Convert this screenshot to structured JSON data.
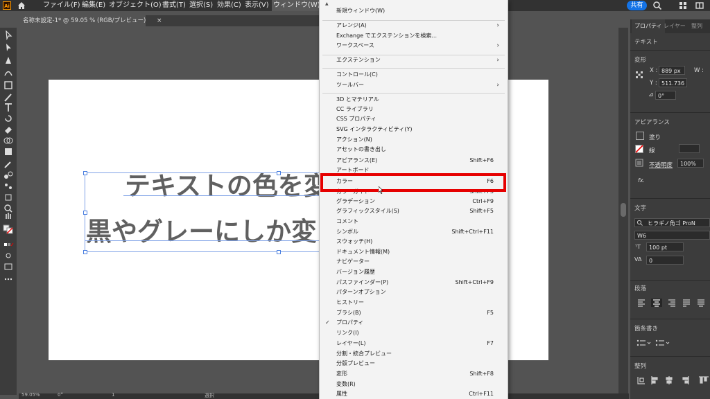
{
  "app": {
    "logo": "Ai",
    "share_label": "共有"
  },
  "menubar": {
    "items": [
      "ファイル(F)",
      "編集(E)",
      "オブジェクト(O)",
      "書式(T)",
      "選択(S)",
      "効果(C)",
      "表示(V)",
      "ウィンドウ(W)"
    ]
  },
  "document_tab": {
    "title": "名称未設定-1* @ 59.05 % (RGB/プレビュー)",
    "close": "×"
  },
  "artboard": {
    "line1": "テキストの色を変",
    "line2": "黒やグレーにしか変"
  },
  "status": {
    "zoom": "59.05%",
    "angle": "0°",
    "page": "1",
    "mode": "選択"
  },
  "window_menu": {
    "items": [
      {
        "label": "新規ウィンドウ(W)",
        "shortcut": ""
      },
      {
        "label": "アレンジ(A)",
        "submenu": true
      },
      {
        "label": "Exchange でエクステンションを検索...",
        "shortcut": ""
      },
      {
        "label": "ワークスペース",
        "submenu": true
      },
      {
        "label": "エクステンション",
        "submenu": true
      },
      {
        "label": "コントロール(C)",
        "shortcut": ""
      },
      {
        "label": "ツールバー",
        "submenu": true
      },
      {
        "label": "3D とマテリアル",
        "shortcut": ""
      },
      {
        "label": "CC ライブラリ",
        "shortcut": ""
      },
      {
        "label": "CSS プロパティ",
        "shortcut": ""
      },
      {
        "label": "SVG インタラクティビティ(Y)",
        "shortcut": ""
      },
      {
        "label": "アクション(N)",
        "shortcut": ""
      },
      {
        "label": "アセットの書き出し",
        "shortcut": ""
      },
      {
        "label": "アピアランス(E)",
        "shortcut": "Shift+F6"
      },
      {
        "label": "アートボード",
        "shortcut": ""
      },
      {
        "label": "カラー",
        "shortcut": "F6"
      },
      {
        "label": "カラーガイド",
        "shortcut": "Shift+F3"
      },
      {
        "label": "グラデーション",
        "shortcut": "Ctrl+F9"
      },
      {
        "label": "グラフィックスタイル(S)",
        "shortcut": "Shift+F5"
      },
      {
        "label": "コメント",
        "shortcut": ""
      },
      {
        "label": "シンボル",
        "shortcut": "Shift+Ctrl+F11"
      },
      {
        "label": "スウォッチ(H)",
        "shortcut": ""
      },
      {
        "label": "ドキュメント情報(M)",
        "shortcut": ""
      },
      {
        "label": "ナビゲーター",
        "shortcut": ""
      },
      {
        "label": "バージョン履歴",
        "shortcut": ""
      },
      {
        "label": "パスファインダー(P)",
        "shortcut": "Shift+Ctrl+F9"
      },
      {
        "label": "パターンオプション",
        "shortcut": ""
      },
      {
        "label": "ヒストリー",
        "shortcut": ""
      },
      {
        "label": "ブラシ(B)",
        "shortcut": "F5"
      },
      {
        "label": "プロパティ",
        "shortcut": "",
        "checked": true
      },
      {
        "label": "リンク(I)",
        "shortcut": ""
      },
      {
        "label": "レイヤー(L)",
        "shortcut": "F7"
      },
      {
        "label": "分割・統合プレビュー",
        "shortcut": ""
      },
      {
        "label": "分版プレビュー",
        "shortcut": ""
      },
      {
        "label": "変形",
        "shortcut": "Shift+F8"
      },
      {
        "label": "変数(R)",
        "shortcut": ""
      },
      {
        "label": "属性",
        "shortcut": "Ctrl+F11"
      }
    ],
    "check_mark": "✓",
    "arrow": "›"
  },
  "properties_panel": {
    "tabs": [
      "プロパティ",
      "レイヤー",
      "整列"
    ],
    "selection_type": "テキスト",
    "transform": {
      "heading": "変形",
      "x_label": "X :",
      "x_value": "889 px",
      "y_label": "Y :",
      "y_value": "511.736",
      "w_label": "W :",
      "angle_value": "0°"
    },
    "appearance": {
      "heading": "アピアランス",
      "fill_label": "塗り",
      "stroke_label": "線",
      "opacity_label": "不透明度",
      "opacity_value": "100%",
      "fx_label": "fx."
    },
    "character": {
      "heading": "文字",
      "font_family": "ヒラギノ角ゴ ProN",
      "font_style": "W6",
      "size_value": "100 pt",
      "tracking_value": "0"
    },
    "paragraph": {
      "heading": "段落"
    },
    "bullets": {
      "heading": "箇条書き"
    },
    "align": {
      "heading": "整列"
    }
  },
  "colors": {
    "accent": "#1473e6",
    "highlight": "#e60000",
    "menu_bg": "#f3f3f3",
    "ui_dark": "#323232"
  }
}
